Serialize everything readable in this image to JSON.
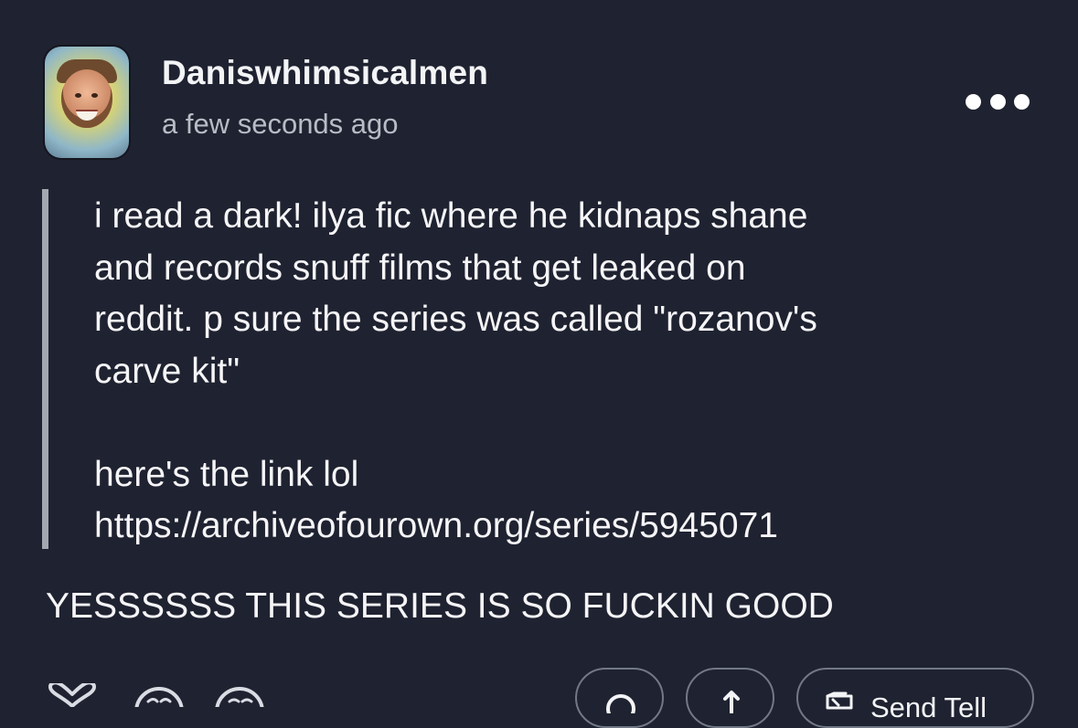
{
  "post": {
    "username": "Daniswhimsicalmen",
    "timestamp": "a few seconds ago",
    "more_label": "•••"
  },
  "quote": {
    "line1": "i read a dark! ilya fic where he kidnaps shane",
    "line2": "and records snuff films that get leaked on",
    "line3": "reddit. p sure the series was called \"rozanov's",
    "line4": "carve kit\"",
    "line5": "here's the link lol",
    "link": "https://archiveofourown.org/series/5945071"
  },
  "reply": {
    "text": "YESSSSSS THIS SERIES IS SO FUCKIN GOOD"
  },
  "actions": {
    "send_label": "Send Tell",
    "icons": [
      "heart-icon",
      "smile-reaction-icon",
      "smile-reaction-icon",
      "comment-icon",
      "share-arrow-icon",
      "send-tell-icon"
    ]
  },
  "colors": {
    "background": "#1f2230",
    "text": "#f3f4f6",
    "muted": "#b8bcc6",
    "quote_bar": "#a3a7b1",
    "pill_border": "#727887"
  }
}
